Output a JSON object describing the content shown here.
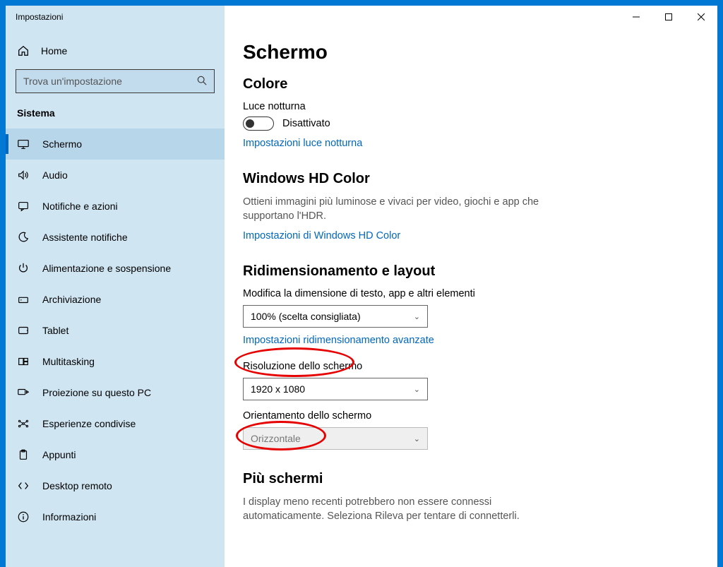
{
  "window": {
    "title": "Impostazioni"
  },
  "sidebar": {
    "home": "Home",
    "search_placeholder": "Trova un'impostazione",
    "category": "Sistema",
    "items": [
      {
        "label": "Schermo",
        "icon": "display",
        "active": true
      },
      {
        "label": "Audio",
        "icon": "audio",
        "active": false
      },
      {
        "label": "Notifiche e azioni",
        "icon": "notifications",
        "active": false
      },
      {
        "label": "Assistente notifiche",
        "icon": "focus",
        "active": false
      },
      {
        "label": "Alimentazione e sospensione",
        "icon": "power",
        "active": false
      },
      {
        "label": "Archiviazione",
        "icon": "storage",
        "active": false
      },
      {
        "label": "Tablet",
        "icon": "tablet",
        "active": false
      },
      {
        "label": "Multitasking",
        "icon": "multitasking",
        "active": false
      },
      {
        "label": "Proiezione su questo PC",
        "icon": "project",
        "active": false
      },
      {
        "label": "Esperienze condivise",
        "icon": "shared",
        "active": false
      },
      {
        "label": "Appunti",
        "icon": "clipboard",
        "active": false
      },
      {
        "label": "Desktop remoto",
        "icon": "remote",
        "active": false
      },
      {
        "label": "Informazioni",
        "icon": "info",
        "active": false
      }
    ]
  },
  "main": {
    "title": "Schermo",
    "color": {
      "heading": "Colore",
      "night_light_label": "Luce notturna",
      "night_light_state": "Disattivato",
      "night_light_link": "Impostazioni luce notturna"
    },
    "hd": {
      "heading": "Windows HD Color",
      "desc": "Ottieni immagini più luminose e vivaci per video, giochi e app che supportano l'HDR.",
      "link": "Impostazioni di Windows HD Color"
    },
    "scale": {
      "heading": "Ridimensionamento e layout",
      "size_label": "Modifica la dimensione di testo, app e altri elementi",
      "size_value": "100% (scelta consigliata)",
      "advanced_link": "Impostazioni ridimensionamento avanzate",
      "resolution_label": "Risoluzione dello schermo",
      "resolution_value": "1920 x 1080",
      "orientation_label": "Orientamento dello schermo",
      "orientation_value": "Orizzontale"
    },
    "multi": {
      "heading": "Più schermi",
      "desc": "I display meno recenti potrebbero non essere connessi automaticamente. Seleziona Rileva per tentare di connetterli."
    }
  },
  "icons": {
    "home": "⌂",
    "display": "🖵",
    "audio": "🔊",
    "notifications": "💬",
    "focus": "☽",
    "power": "⏻",
    "storage": "🖴",
    "tablet": "▭",
    "multitasking": "⧉",
    "project": "⇥",
    "shared": "✶",
    "clipboard": "📋",
    "remote": "><",
    "info": "ⓘ",
    "search": "🔍"
  }
}
